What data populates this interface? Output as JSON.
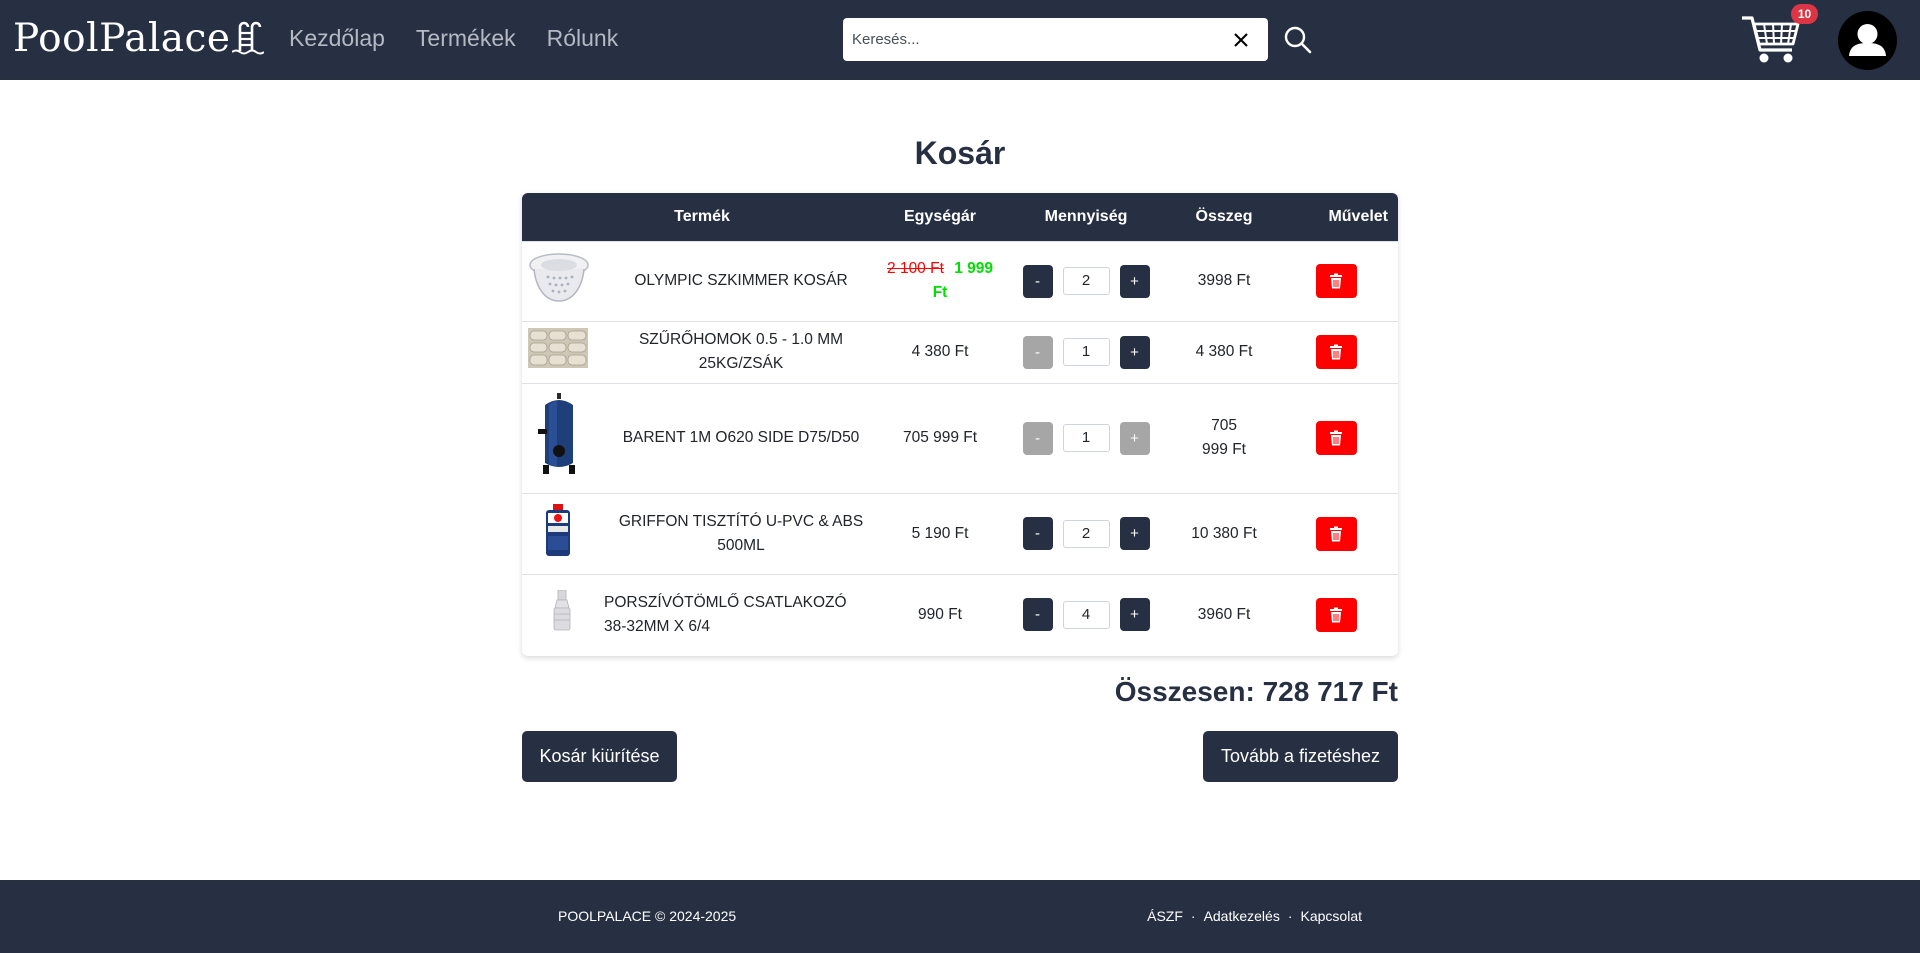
{
  "brand": {
    "name": "PoolPalace",
    "icon": "pool-ladder-icon"
  },
  "nav": {
    "links": [
      "Kezdőlap",
      "Termékek",
      "Rólunk"
    ]
  },
  "search": {
    "placeholder": "Keresés...",
    "value": "",
    "clear_icon": "close-icon",
    "search_icon": "search-icon"
  },
  "cart": {
    "icon": "shopping-cart-icon",
    "badge": "10"
  },
  "user": {
    "icon": "user-avatar-icon"
  },
  "page": {
    "title": "Kosár"
  },
  "table": {
    "headers": [
      "Termék",
      "Egységár",
      "Mennyiség",
      "Összeg",
      "Művelet"
    ],
    "rows": [
      {
        "image": "skimmer-basket-image",
        "name": "OLYMPIC SZKIMMER KOSÁR",
        "old_price": "2 100 Ft",
        "price": "1 999 Ft",
        "minus": "-",
        "qty": "2",
        "plus": "+",
        "minus_disabled": false,
        "plus_disabled": false,
        "total": "3998 Ft",
        "delete_icon": "trash-icon"
      },
      {
        "image": "sand-bags-image",
        "name": "SZŰRŐHOMOK 0.5 - 1.0 MM 25KG/ZSÁK",
        "old_price": "",
        "price": "4 380 Ft",
        "minus": "-",
        "qty": "1",
        "plus": "+",
        "minus_disabled": true,
        "plus_disabled": false,
        "total": "4 380 Ft",
        "delete_icon": "trash-icon"
      },
      {
        "image": "sand-filter-tank-image",
        "name": "BARENT 1M O620 SIDE D75/D50",
        "old_price": "",
        "price": "705 999 Ft",
        "minus": "-",
        "qty": "1",
        "plus": "+",
        "minus_disabled": true,
        "plus_disabled": true,
        "total": "705 999 Ft",
        "delete_icon": "trash-icon"
      },
      {
        "image": "cleaner-can-image",
        "name": "GRIFFON TISZTÍTÓ U-PVC & ABS 500ML",
        "old_price": "",
        "price": "5 190 Ft",
        "minus": "-",
        "qty": "2",
        "plus": "+",
        "minus_disabled": false,
        "plus_disabled": false,
        "total": "10 380 Ft",
        "delete_icon": "trash-icon"
      },
      {
        "image": "hose-connector-image",
        "name": "PORSZÍVÓTÖMLŐ CSATLAKOZÓ 38-32MM X 6/4",
        "old_price": "",
        "price": "990 Ft",
        "minus": "-",
        "qty": "4",
        "plus": "+",
        "minus_disabled": false,
        "plus_disabled": false,
        "total": "3960 Ft",
        "delete_icon": "trash-icon"
      }
    ]
  },
  "summary": {
    "total": "Összesen: 728 717 Ft"
  },
  "actions": {
    "clear_cart": "Kosár kiürítése",
    "checkout": "Tovább a fizetéshez"
  },
  "footer": {
    "copyright": "POOLPALACE © 2024-2025",
    "links": [
      "ÁSZF",
      "Adatkezelés",
      "Kapcsolat"
    ],
    "separator": "·"
  },
  "colors": {
    "navbar": "#273043",
    "danger": "#ff0000",
    "sale": "#00e000",
    "badge": "#dc3545",
    "muted_button": "#a6a6a6"
  }
}
